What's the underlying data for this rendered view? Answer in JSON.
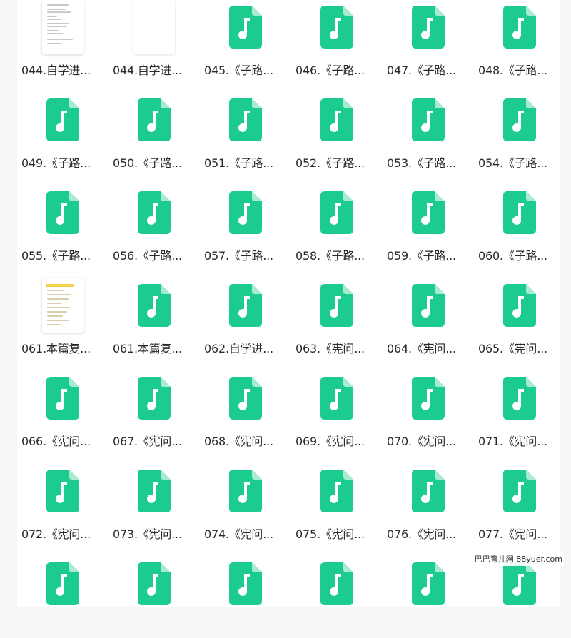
{
  "files": [
    {
      "name": "044.自学进...",
      "type": "doc"
    },
    {
      "name": "044.自学进...",
      "type": "doc-blank"
    },
    {
      "name": "045.《子路...",
      "type": "audio"
    },
    {
      "name": "046.《子路...",
      "type": "audio"
    },
    {
      "name": "047.《子路...",
      "type": "audio"
    },
    {
      "name": "048.《子路...",
      "type": "audio"
    },
    {
      "name": "049.《子路...",
      "type": "audio"
    },
    {
      "name": "050.《子路...",
      "type": "audio"
    },
    {
      "name": "051.《子路...",
      "type": "audio"
    },
    {
      "name": "052.《子路...",
      "type": "audio"
    },
    {
      "name": "053.《子路...",
      "type": "audio"
    },
    {
      "name": "054.《子路...",
      "type": "audio"
    },
    {
      "name": "055.《子路...",
      "type": "audio"
    },
    {
      "name": "056.《子路...",
      "type": "audio"
    },
    {
      "name": "057.《子路...",
      "type": "audio"
    },
    {
      "name": "058.《子路...",
      "type": "audio"
    },
    {
      "name": "059.《子路...",
      "type": "audio"
    },
    {
      "name": "060.《子路...",
      "type": "audio"
    },
    {
      "name": "061.本篇复...",
      "type": "doc-review"
    },
    {
      "name": "061.本篇复...",
      "type": "audio"
    },
    {
      "name": "062.自学进...",
      "type": "audio"
    },
    {
      "name": "063.《宪问...",
      "type": "audio"
    },
    {
      "name": "064.《宪问...",
      "type": "audio"
    },
    {
      "name": "065.《宪问...",
      "type": "audio"
    },
    {
      "name": "066.《宪问...",
      "type": "audio"
    },
    {
      "name": "067.《宪问...",
      "type": "audio"
    },
    {
      "name": "068.《宪问...",
      "type": "audio"
    },
    {
      "name": "069.《宪问...",
      "type": "audio"
    },
    {
      "name": "070.《宪问...",
      "type": "audio"
    },
    {
      "name": "071.《宪问...",
      "type": "audio"
    },
    {
      "name": "072.《宪问...",
      "type": "audio"
    },
    {
      "name": "073.《宪问...",
      "type": "audio"
    },
    {
      "name": "074.《宪问...",
      "type": "audio"
    },
    {
      "name": "075.《宪问...",
      "type": "audio"
    },
    {
      "name": "076.《宪问...",
      "type": "audio"
    },
    {
      "name": "077.《宪问...",
      "type": "audio"
    },
    {
      "name": "",
      "type": "audio"
    },
    {
      "name": "",
      "type": "audio"
    },
    {
      "name": "",
      "type": "audio"
    },
    {
      "name": "",
      "type": "audio"
    },
    {
      "name": "",
      "type": "audio"
    },
    {
      "name": "",
      "type": "audio"
    }
  ],
  "watermark": "巴巴育儿网 88yuer.com",
  "colors": {
    "audio": "#1ccc8f",
    "audio_fold": "#a8ebd1"
  },
  "icons": {
    "audio": "music-file-icon",
    "doc": "document-thumbnail"
  }
}
